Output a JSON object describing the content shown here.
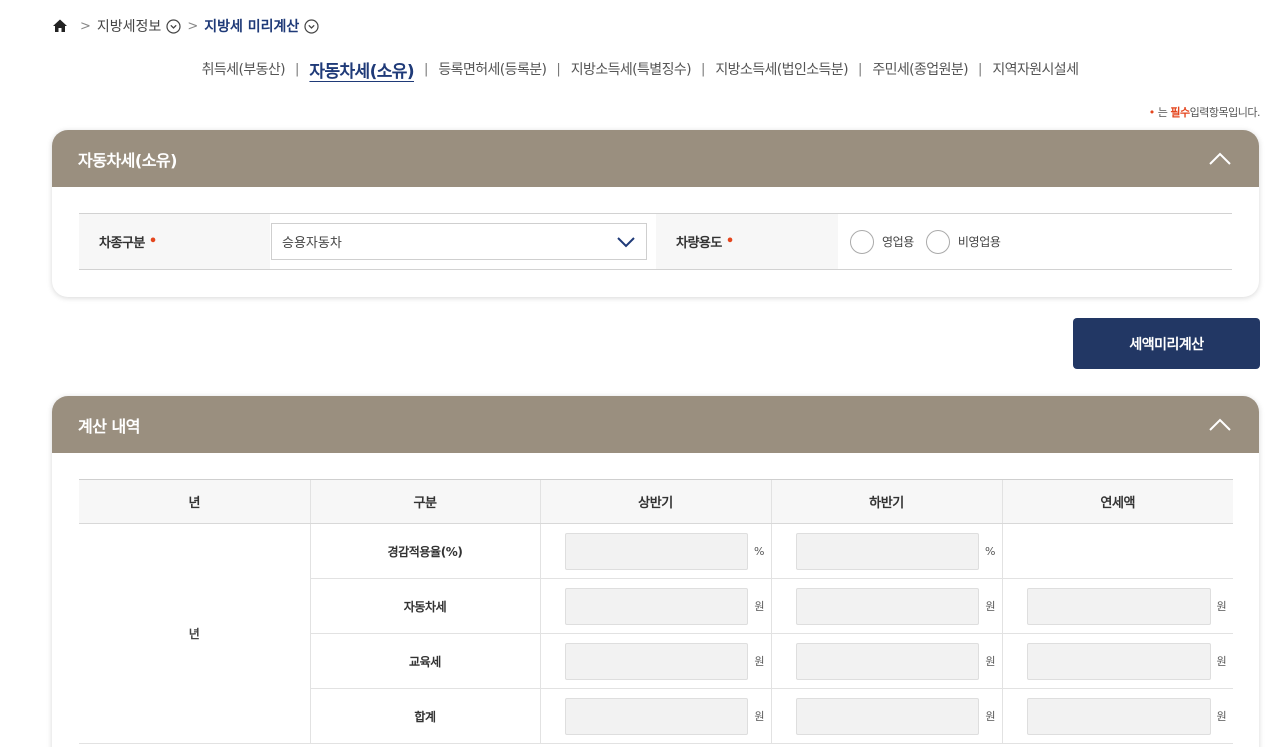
{
  "breadcrumb": {
    "items": [
      "지방세정보",
      "지방세 미리계산"
    ]
  },
  "tabs": [
    {
      "label": "취득세(부동산)"
    },
    {
      "label": "자동차세(소유)",
      "active": true
    },
    {
      "label": "등록면허세(등록분)"
    },
    {
      "label": "지방소득세(특별징수)"
    },
    {
      "label": "지방소득세(법인소득분)"
    },
    {
      "label": "주민세(종업원분)"
    },
    {
      "label": "지역자원시설세"
    }
  ],
  "required_note": {
    "dot": "•",
    "prefix": "는",
    "emphasis": "필수",
    "suffix": "입력항목입니다."
  },
  "vehicle_panel": {
    "title": "자동차세(소유)",
    "type_label": "차종구분",
    "type_value": "승용자동차",
    "usage_label": "차량용도",
    "required_mark": "•",
    "usage_options": [
      "영업용",
      "비영업용"
    ]
  },
  "calc_button": {
    "label": "세액미리계산"
  },
  "result_panel": {
    "title": "계산 내역",
    "headers": [
      "년",
      "구분",
      "상반기",
      "하반기",
      "연세액"
    ],
    "year_cell": "년",
    "rows": [
      {
        "label": "경감적용율(%)",
        "unit_h1": "%",
        "unit_h2": "%",
        "unit_year": ""
      },
      {
        "label": "자동차세",
        "unit_h1": "원",
        "unit_h2": "원",
        "unit_year": "원"
      },
      {
        "label": "교육세",
        "unit_h1": "원",
        "unit_h2": "원",
        "unit_year": "원"
      },
      {
        "label": "합계",
        "unit_h1": "원",
        "unit_h2": "원",
        "unit_year": "원"
      }
    ]
  },
  "colors": {
    "panel_header": "#9a8f7f",
    "accent_navy": "#223764",
    "active_tab": "#1f3a78",
    "required_red": "#e4461e"
  }
}
